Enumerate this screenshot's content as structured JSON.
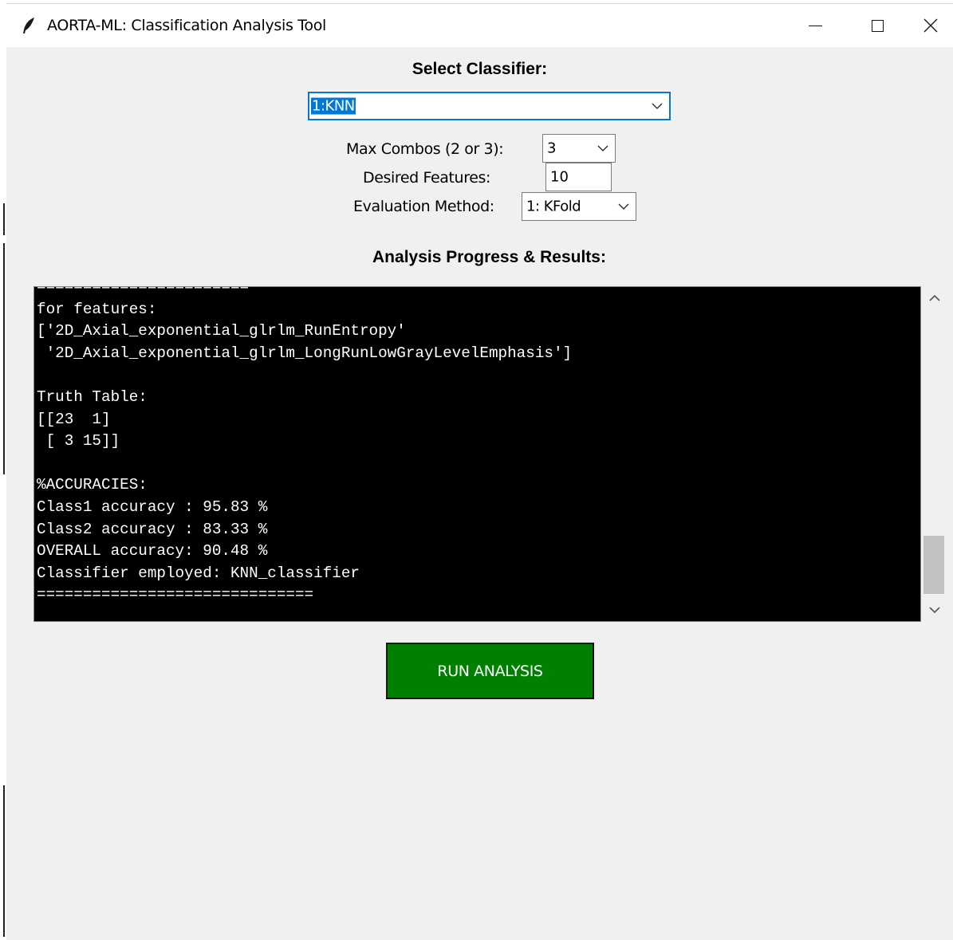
{
  "window": {
    "title": "AORTA-ML: Classification Analysis Tool",
    "app_icon": "feather-icon",
    "controls": [
      "minimize-icon",
      "maximize-icon",
      "close-icon"
    ],
    "close_glyph": "✕"
  },
  "classifier": {
    "label": "Select Classifier:",
    "selected": "1:KNN"
  },
  "max_combos": {
    "label": "Max Combos (2 or 3):",
    "selected": "3"
  },
  "desired_features": {
    "label": "Desired Features:",
    "value": "10"
  },
  "evaluation_method": {
    "label": "Evaluation Method:",
    "selected": "1: KFold"
  },
  "results": {
    "label": "Analysis Progress & Results:",
    "console_text": "=======================\nfor features:\n['2D_Axial_exponential_glrlm_RunEntropy'\n '2D_Axial_exponential_glrlm_LongRunLowGrayLevelEmphasis']\n\nTruth Table:\n[[23  1]\n [ 3 15]]\n\n%ACCURACIES:\nClass1 accuracy : 95.83 %\nClass2 accuracy : 83.33 %\nOVERALL accuracy: 90.48 %\nClassifier employed: KNN_classifier\n=============================="
  },
  "run_button": {
    "label": "RUN ANALYSIS",
    "color": "#008000"
  },
  "colors": {
    "accent": "#0078d7",
    "console_bg": "#000000",
    "console_fg": "#ffffff"
  }
}
